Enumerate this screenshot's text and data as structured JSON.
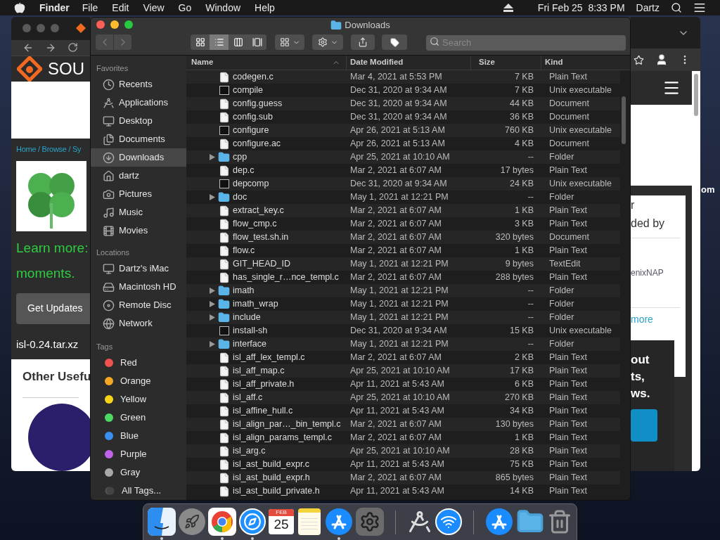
{
  "menubar": {
    "app": "Finder",
    "menus": [
      "File",
      "Edit",
      "View",
      "Go",
      "Window",
      "Help"
    ],
    "clock": "Fri Feb 25  8:33 PM",
    "user": "Dartz"
  },
  "browser": {
    "logo_text": "SOU",
    "breadcrumb": "Home / Browse / Sy",
    "promo_lines": [
      "Learn more:",
      "moments."
    ],
    "button": "Get Updates",
    "file_name": "isl-0.24.tar.xz",
    "section_title": "Other Usefu",
    "card_lines": [
      "r",
      "ded by"
    ],
    "sponsor": "enixNAP",
    "more_link": "more",
    "dark_lines": [
      "out",
      "ts,",
      "ws."
    ]
  },
  "desktop_text": "om",
  "finder": {
    "title": "Downloads",
    "view_modes": [
      {
        "selected": false
      },
      {
        "selected": true
      },
      {
        "selected": false
      },
      {
        "selected": false
      }
    ],
    "search": {
      "placeholder": "Search"
    },
    "sidebar": [
      {
        "heading": "Favorites",
        "items": [
          {
            "label": "Recents",
            "selected": false
          },
          {
            "label": "Applications",
            "selected": false
          },
          {
            "label": "Desktop",
            "selected": false
          },
          {
            "label": "Documents",
            "selected": false
          },
          {
            "label": "Downloads",
            "selected": true
          },
          {
            "label": "dartz",
            "selected": false
          },
          {
            "label": "Pictures",
            "selected": false
          },
          {
            "label": "Music",
            "selected": false
          },
          {
            "label": "Movies",
            "selected": false
          }
        ]
      },
      {
        "heading": "Locations",
        "items": [
          {
            "label": "Dartz's iMac",
            "selected": false
          },
          {
            "label": "Macintosh HD",
            "selected": false
          },
          {
            "label": "Remote Disc",
            "selected": false
          },
          {
            "label": "Network",
            "selected": false
          }
        ]
      }
    ],
    "tags": {
      "heading": "Tags",
      "items": [
        {
          "label": "Red",
          "color": "#ef5350"
        },
        {
          "label": "Orange",
          "color": "#f5a623"
        },
        {
          "label": "Yellow",
          "color": "#f8d31c"
        },
        {
          "label": "Green",
          "color": "#4cd964"
        },
        {
          "label": "Blue",
          "color": "#3a8ff0"
        },
        {
          "label": "Purple",
          "color": "#c063e8"
        },
        {
          "label": "Gray",
          "color": "#a8a8a8"
        },
        {
          "label": "All Tags..."
        }
      ]
    },
    "columns": [
      "Name",
      "Date Modified",
      "Size",
      "Kind"
    ],
    "rows": [
      {
        "name": "codegen.c",
        "date": "Mar 4, 2021 at 5:53 PM",
        "size": "7 KB",
        "kind_text": "Plain Text",
        "kind": "file"
      },
      {
        "name": "compile",
        "date": "Dec 31, 2020 at 9:34 AM",
        "size": "7 KB",
        "kind_text": "Unix executable",
        "kind": "exec"
      },
      {
        "name": "config.guess",
        "date": "Dec 31, 2020 at 9:34 AM",
        "size": "44 KB",
        "kind_text": "Document",
        "kind": "file"
      },
      {
        "name": "config.sub",
        "date": "Dec 31, 2020 at 9:34 AM",
        "size": "36 KB",
        "kind_text": "Document",
        "kind": "file"
      },
      {
        "name": "configure",
        "date": "Apr 26, 2021 at 5:13 AM",
        "size": "760 KB",
        "kind_text": "Unix executable",
        "kind": "exec"
      },
      {
        "name": "configure.ac",
        "date": "Apr 26, 2021 at 5:13 AM",
        "size": "4 KB",
        "kind_text": "Document",
        "kind": "file"
      },
      {
        "name": "cpp",
        "date": "Apr 25, 2021 at 10:10 AM",
        "size": "--",
        "kind_text": "Folder",
        "kind": "folder",
        "expanded": false
      },
      {
        "name": "dep.c",
        "date": "Mar 2, 2021 at 6:07 AM",
        "size": "17 bytes",
        "kind_text": "Plain Text",
        "kind": "file"
      },
      {
        "name": "depcomp",
        "date": "Dec 31, 2020 at 9:34 AM",
        "size": "24 KB",
        "kind_text": "Unix executable",
        "kind": "exec"
      },
      {
        "name": "doc",
        "date": "May 1, 2021 at 12:21 PM",
        "size": "--",
        "kind_text": "Folder",
        "kind": "folder",
        "expanded": false
      },
      {
        "name": "extract_key.c",
        "date": "Mar 2, 2021 at 6:07 AM",
        "size": "1 KB",
        "kind_text": "Plain Text",
        "kind": "file"
      },
      {
        "name": "flow_cmp.c",
        "date": "Mar 2, 2021 at 6:07 AM",
        "size": "3 KB",
        "kind_text": "Plain Text",
        "kind": "file"
      },
      {
        "name": "flow_test.sh.in",
        "date": "Mar 2, 2021 at 6:07 AM",
        "size": "320 bytes",
        "kind_text": "Document",
        "kind": "file"
      },
      {
        "name": "flow.c",
        "date": "Mar 2, 2021 at 6:07 AM",
        "size": "1 KB",
        "kind_text": "Plain Text",
        "kind": "file"
      },
      {
        "name": "GIT_HEAD_ID",
        "date": "May 1, 2021 at 12:21 PM",
        "size": "9 bytes",
        "kind_text": "TextEdit",
        "kind": "file"
      },
      {
        "name": "has_single_r…nce_templ.c",
        "date": "Mar 2, 2021 at 6:07 AM",
        "size": "288 bytes",
        "kind_text": "Plain Text",
        "kind": "file"
      },
      {
        "name": "imath",
        "date": "May 1, 2021 at 12:21 PM",
        "size": "--",
        "kind_text": "Folder",
        "kind": "folder",
        "expanded": false
      },
      {
        "name": "imath_wrap",
        "date": "May 1, 2021 at 12:21 PM",
        "size": "--",
        "kind_text": "Folder",
        "kind": "folder",
        "expanded": false
      },
      {
        "name": "include",
        "date": "May 1, 2021 at 12:21 PM",
        "size": "--",
        "kind_text": "Folder",
        "kind": "folder",
        "expanded": false
      },
      {
        "name": "install-sh",
        "date": "Dec 31, 2020 at 9:34 AM",
        "size": "15 KB",
        "kind_text": "Unix executable",
        "kind": "exec"
      },
      {
        "name": "interface",
        "date": "May 1, 2021 at 12:21 PM",
        "size": "--",
        "kind_text": "Folder",
        "kind": "folder",
        "expanded": false
      },
      {
        "name": "isl_aff_lex_templ.c",
        "date": "Mar 2, 2021 at 6:07 AM",
        "size": "2 KB",
        "kind_text": "Plain Text",
        "kind": "file"
      },
      {
        "name": "isl_aff_map.c",
        "date": "Apr 25, 2021 at 10:10 AM",
        "size": "17 KB",
        "kind_text": "Plain Text",
        "kind": "file"
      },
      {
        "name": "isl_aff_private.h",
        "date": "Apr 11, 2021 at 5:43 AM",
        "size": "6 KB",
        "kind_text": "Plain Text",
        "kind": "file"
      },
      {
        "name": "isl_aff.c",
        "date": "Apr 25, 2021 at 10:10 AM",
        "size": "270 KB",
        "kind_text": "Plain Text",
        "kind": "file"
      },
      {
        "name": "isl_affine_hull.c",
        "date": "Apr 11, 2021 at 5:43 AM",
        "size": "34 KB",
        "kind_text": "Plain Text",
        "kind": "file"
      },
      {
        "name": "isl_align_par…_bin_templ.c",
        "date": "Mar 2, 2021 at 6:07 AM",
        "size": "130 bytes",
        "kind_text": "Plain Text",
        "kind": "file"
      },
      {
        "name": "isl_align_params_templ.c",
        "date": "Mar 2, 2021 at 6:07 AM",
        "size": "1 KB",
        "kind_text": "Plain Text",
        "kind": "file"
      },
      {
        "name": "isl_arg.c",
        "date": "Apr 25, 2021 at 10:10 AM",
        "size": "28 KB",
        "kind_text": "Plain Text",
        "kind": "file"
      },
      {
        "name": "isl_ast_build_expr.c",
        "date": "Apr 11, 2021 at 5:43 AM",
        "size": "75 KB",
        "kind_text": "Plain Text",
        "kind": "file"
      },
      {
        "name": "isl_ast_build_expr.h",
        "date": "Mar 2, 2021 at 6:07 AM",
        "size": "865 bytes",
        "kind_text": "Plain Text",
        "kind": "file"
      },
      {
        "name": "isl_ast_build_private.h",
        "date": "Apr 11, 2021 at 5:43 AM",
        "size": "14 KB",
        "kind_text": "Plain Text",
        "kind": "file"
      }
    ]
  },
  "dock": [
    {
      "kind": "finder",
      "running": true
    },
    {
      "kind": "launchpad",
      "running": false
    },
    {
      "kind": "chrome",
      "running": true
    },
    {
      "kind": "safari",
      "running": true
    },
    {
      "kind": "calendar",
      "running": false,
      "month": "FEB",
      "day": "25"
    },
    {
      "kind": "notes",
      "running": false
    },
    {
      "kind": "appstore",
      "running": true
    },
    {
      "kind": "settings",
      "running": false
    },
    {
      "kind": "separator"
    },
    {
      "kind": "tool",
      "running": false
    },
    {
      "kind": "wifi",
      "running": false
    },
    {
      "kind": "separator"
    },
    {
      "kind": "appstore",
      "running": false
    },
    {
      "kind": "folder",
      "running": false
    },
    {
      "kind": "trash",
      "running": false
    }
  ]
}
